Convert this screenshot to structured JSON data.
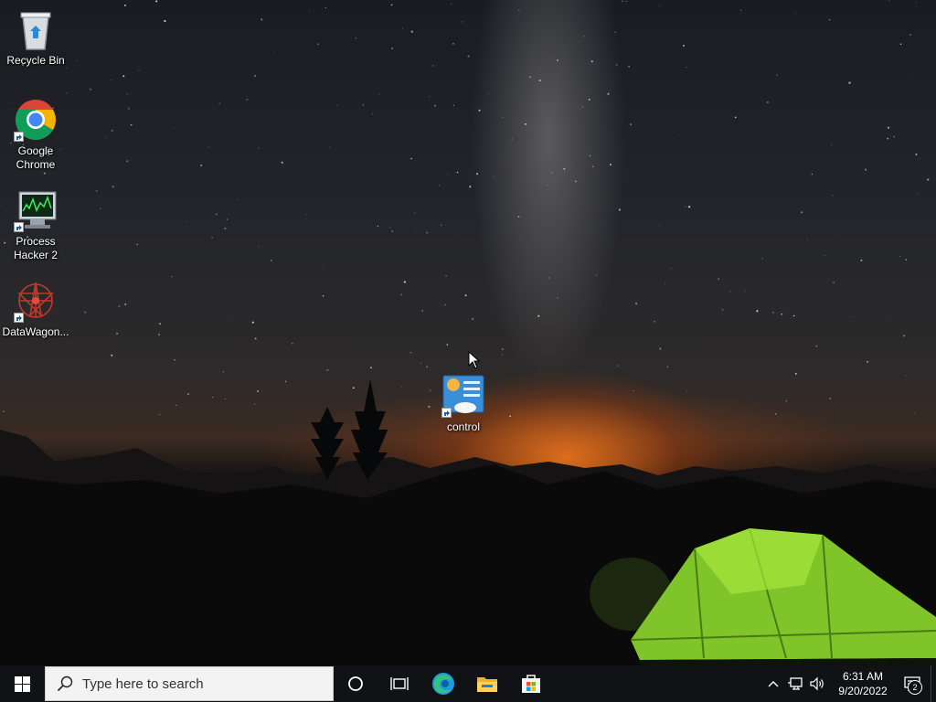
{
  "desktop": {
    "icons": [
      {
        "label": "Recycle Bin",
        "icon": "recycle-bin-icon",
        "shortcut": false
      },
      {
        "label": "Google\nChrome",
        "icon": "chrome-icon",
        "shortcut": true
      },
      {
        "label": "Process\nHacker 2",
        "icon": "process-hacker-icon",
        "shortcut": true
      },
      {
        "label": "DataWagon...",
        "icon": "datawagon-icon",
        "shortcut": true
      },
      {
        "label": "control",
        "icon": "control-panel-icon",
        "shortcut": true
      }
    ]
  },
  "taskbar": {
    "search_placeholder": "Type here to search",
    "pinned": [
      "start-icon",
      "cortana-icon",
      "task-view-icon",
      "edge-icon",
      "file-explorer-icon",
      "store-icon"
    ],
    "tray": {
      "time": "6:31 AM",
      "date": "9/20/2022",
      "notification_count": "2"
    }
  },
  "colors": {
    "taskbar": "#101216",
    "accent_orange": "#e8741f",
    "tent_green": "#8fd62b"
  }
}
